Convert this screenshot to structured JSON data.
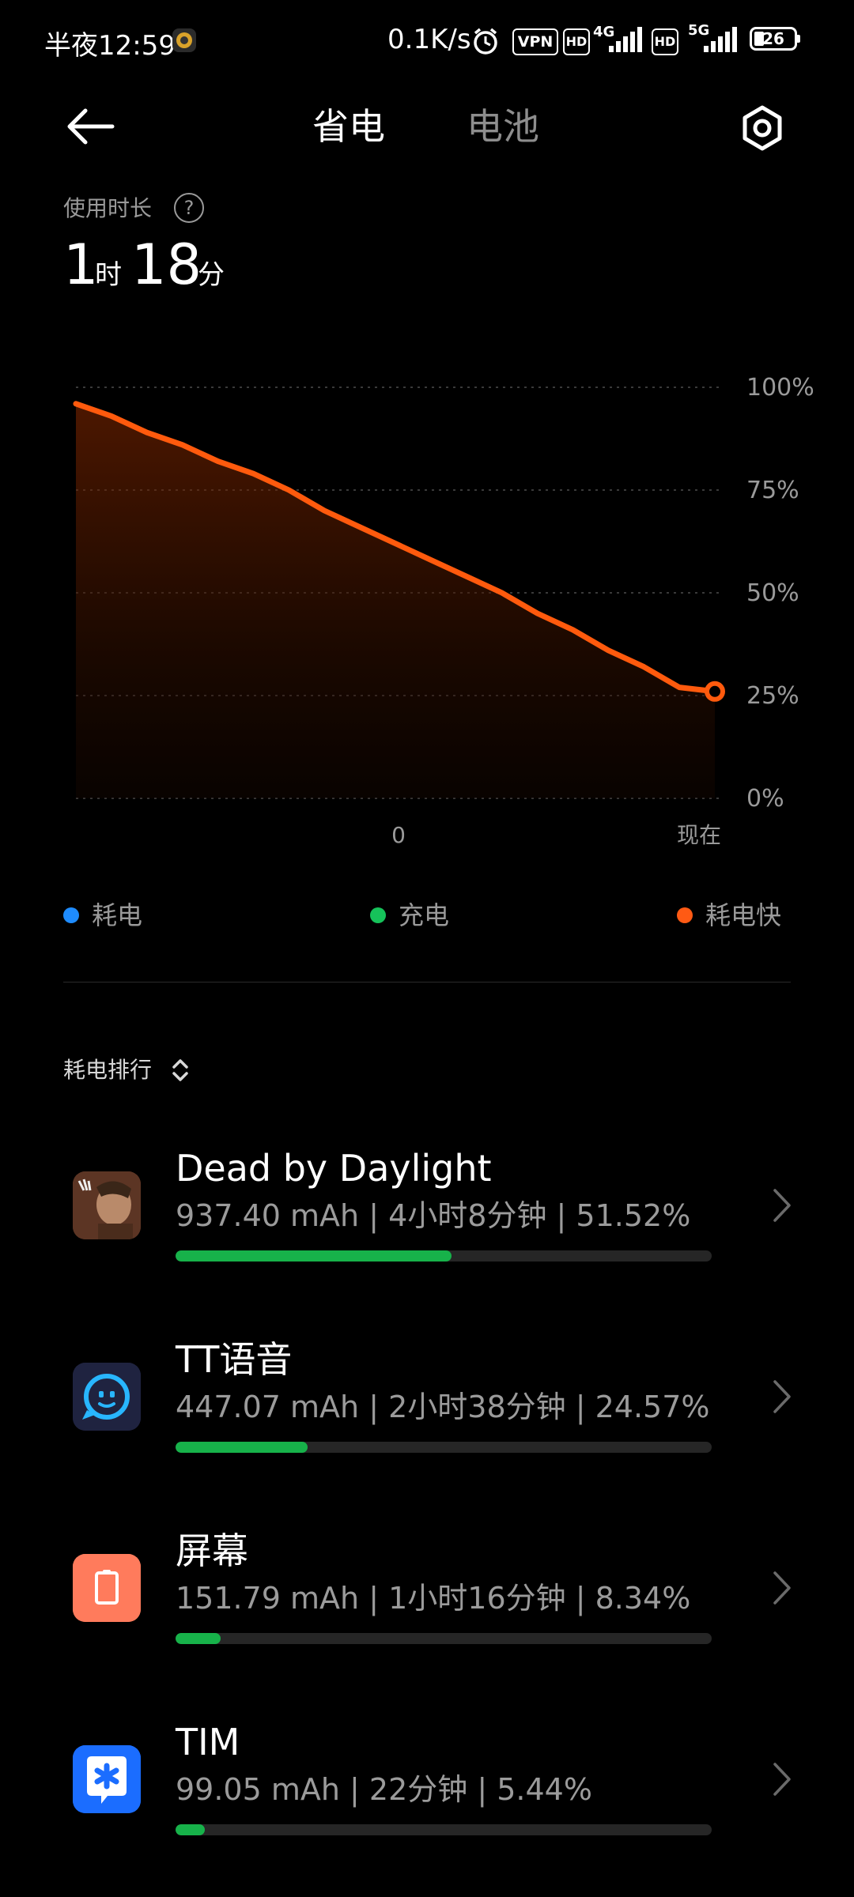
{
  "status_bar": {
    "time": "半夜12:59",
    "net_speed": "0.1K/s",
    "vpn": "VPN",
    "hd1": "HD",
    "net1": "4G",
    "hd2": "HD",
    "net2": "5G",
    "battery": "26",
    "icons": [
      "notification-app-icon",
      "alarm-icon",
      "vpn-icon",
      "hd-icon",
      "signal-4g-icon",
      "hd-icon",
      "signal-5g-icon",
      "battery-icon"
    ]
  },
  "header": {
    "tabs": [
      "省电",
      "电池"
    ],
    "active_tab": 0,
    "back_icon": "back-arrow-icon",
    "settings_icon": "settings-hexagon-icon"
  },
  "usage": {
    "label": "使用时长",
    "hours": "1",
    "hours_unit": "时",
    "minutes": "18",
    "minutes_unit": "分"
  },
  "chart_data": {
    "type": "area",
    "x": [
      "",
      "0",
      "现在"
    ],
    "y_ticks": [
      "100%",
      "75%",
      "50%",
      "25%",
      "0%"
    ],
    "ylim": [
      0,
      100
    ],
    "series": [
      {
        "values": [
          96,
          93,
          89,
          86,
          82,
          79,
          75,
          70,
          66,
          62,
          58,
          54,
          50,
          45,
          41,
          36,
          32,
          27,
          26
        ]
      }
    ],
    "line_color": "#ff5a0d",
    "grid": true
  },
  "legend": [
    {
      "label": "耗电",
      "color": "#1e8cff"
    },
    {
      "label": "充电",
      "color": "#16c25a"
    },
    {
      "label": "耗电快",
      "color": "#ff5a14"
    }
  ],
  "ranking": {
    "label": "耗电排行",
    "sort_icon": "sort-updown-icon",
    "items": [
      {
        "name": "Dead by Daylight",
        "stats": "937.40 mAh | 4小时8分钟 | 51.52%",
        "share": 0.5152,
        "icon": "dead-by-daylight-icon"
      },
      {
        "name": "TT语音",
        "stats": "447.07 mAh | 2小时38分钟 | 24.57%",
        "share": 0.2457,
        "icon": "tt-voice-icon"
      },
      {
        "name": "屏幕",
        "stats": "151.79 mAh | 1小时16分钟 | 8.34%",
        "share": 0.0834,
        "icon": "screen-icon"
      },
      {
        "name": "TIM",
        "stats": "99.05 mAh | 22分钟 | 5.44%",
        "share": 0.0544,
        "icon": "tim-icon"
      }
    ]
  },
  "colors": {
    "accent_orange": "#ff5a0d",
    "bar_green": "#17b24a",
    "background": "#000000"
  }
}
